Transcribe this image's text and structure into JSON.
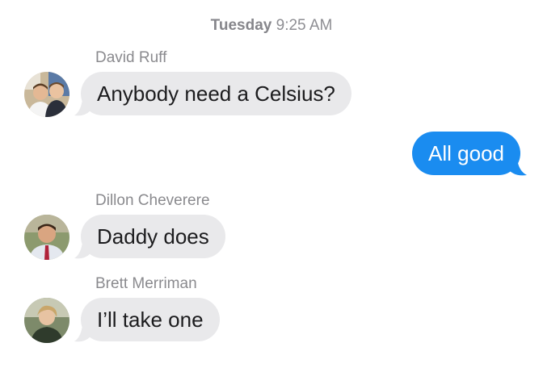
{
  "timestamp": {
    "day": "Tuesday",
    "time": "9:25 AM"
  },
  "messages": [
    {
      "sender": "David Ruff",
      "text": "Anybody need a Celsius?",
      "direction": "incoming"
    },
    {
      "sender": "",
      "text": "All good",
      "direction": "outgoing"
    },
    {
      "sender": "Dillon Cheverere",
      "text": "Daddy does",
      "direction": "incoming"
    },
    {
      "sender": "Brett Merriman",
      "text": "I’ll take one",
      "direction": "incoming"
    }
  ],
  "colors": {
    "incoming_bubble": "#e9e9eb",
    "outgoing_bubble": "#1a8cf0",
    "sender_name": "#8a8a8e"
  }
}
